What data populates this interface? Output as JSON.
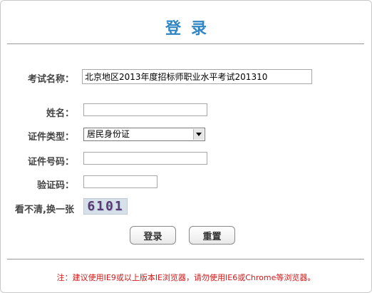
{
  "header": {
    "title": "登录"
  },
  "form": {
    "exam_label": "考试名称：",
    "exam_value": "北京地区2013年度招标师职业水平考试201310",
    "name_label": "姓名：",
    "name_value": "",
    "idtype_label": "证件类型：",
    "idtype_value": "居民身份证",
    "idnum_label": "证件号码：",
    "idnum_value": "",
    "captcha_label": "验证码：",
    "captcha_value": "",
    "refresh_label": "看不清,换一张",
    "captcha_text": "6101"
  },
  "buttons": {
    "login": "登录",
    "reset": "重置"
  },
  "footer": {
    "note": "注：建议使用IE9或以上版本IE浏览器，请勿使用IE6或Chrome等浏览器。"
  },
  "colors": {
    "title": "#2f86c3",
    "note": "#d11a1a"
  },
  "icons": {
    "select_arrow": "chevron-down-icon"
  }
}
